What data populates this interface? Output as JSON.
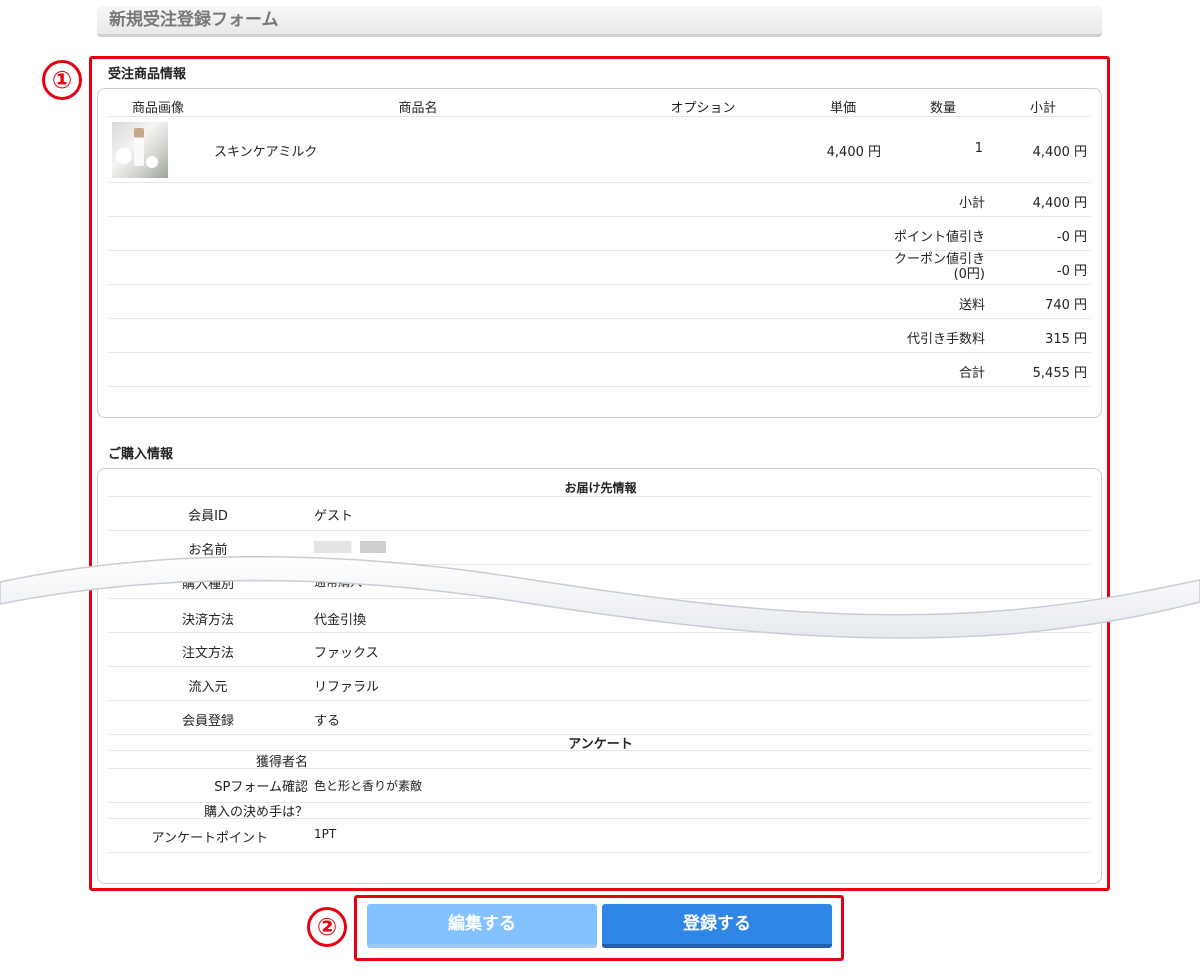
{
  "page_title": "新規受注登録フォーム",
  "markers": [
    "①",
    "②"
  ],
  "order_items": {
    "section_title": "受注商品情報",
    "columns": [
      "商品画像",
      "商品名",
      "オプション",
      "単価",
      "数量",
      "小計"
    ],
    "items": [
      {
        "name": "スキンケアミルク",
        "option": "",
        "unit_price": "4,400 円",
        "quantity": "1",
        "subtotal": "4,400 円"
      }
    ],
    "totals": [
      {
        "label": "小計",
        "value": "4,400 円"
      },
      {
        "label": "ポイント値引き",
        "value": "-0 円"
      },
      {
        "label": "クーポン値引き\n(0円)",
        "value": "-0 円"
      },
      {
        "label": "送料",
        "value": "740 円"
      },
      {
        "label": "代引き手数料",
        "value": "315 円"
      },
      {
        "label": "合計",
        "value": "5,455 円"
      }
    ]
  },
  "purchase_info": {
    "section_title": "ご購入情報",
    "delivery_heading": "お届け先情報",
    "fields": [
      {
        "label": "会員ID",
        "value": "ゲスト"
      },
      {
        "label": "お名前",
        "value": ""
      },
      {
        "label": "購入種別",
        "value": "通常購入"
      },
      {
        "label": "決済方法",
        "value": "代金引換"
      },
      {
        "label": "注文方法",
        "value": "ファックス"
      },
      {
        "label": "流入元",
        "value": "リファラル"
      },
      {
        "label": "会員登録",
        "value": "する"
      }
    ],
    "survey_heading": "アンケート",
    "survey": [
      {
        "label": "獲得者名",
        "value": ""
      },
      {
        "label": "SPフォーム確認",
        "value": "色と形と香りが素敵"
      },
      {
        "label": "購入の決め手は？",
        "value": ""
      },
      {
        "label": "アンケートポイント",
        "value": "1PT"
      }
    ]
  },
  "buttons": {
    "edit": "編集する",
    "register": "登録する"
  }
}
